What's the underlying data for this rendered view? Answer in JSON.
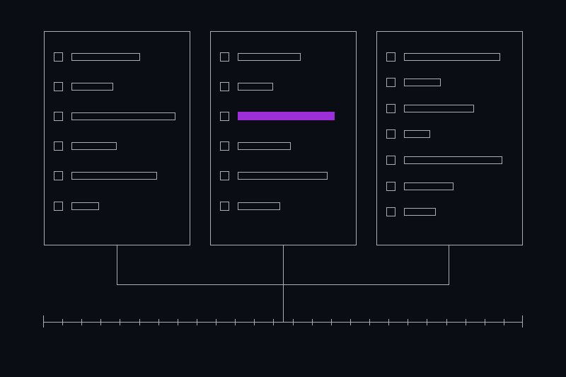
{
  "colors": {
    "background": "#0b0d14",
    "line": "#a9adb6",
    "highlight": "#9b2fd8"
  },
  "lists": [
    {
      "name": "left",
      "rows": [
        {
          "bar_fraction": 0.66,
          "selected": false
        },
        {
          "bar_fraction": 0.4,
          "selected": false
        },
        {
          "bar_fraction": 1.0,
          "selected": false
        },
        {
          "bar_fraction": 0.43,
          "selected": false
        },
        {
          "bar_fraction": 0.82,
          "selected": false
        },
        {
          "bar_fraction": 0.26,
          "selected": false
        }
      ]
    },
    {
      "name": "middle",
      "rows": [
        {
          "bar_fraction": 0.64,
          "selected": false
        },
        {
          "bar_fraction": 0.36,
          "selected": false
        },
        {
          "bar_fraction": 1.0,
          "selected": true
        },
        {
          "bar_fraction": 0.54,
          "selected": false
        },
        {
          "bar_fraction": 0.92,
          "selected": false
        },
        {
          "bar_fraction": 0.43,
          "selected": false
        }
      ]
    },
    {
      "name": "right",
      "rows": [
        {
          "bar_fraction": 0.98,
          "selected": false
        },
        {
          "bar_fraction": 0.37,
          "selected": false
        },
        {
          "bar_fraction": 0.71,
          "selected": false
        },
        {
          "bar_fraction": 0.26,
          "selected": false
        },
        {
          "bar_fraction": 1.0,
          "selected": false
        },
        {
          "bar_fraction": 0.5,
          "selected": false
        },
        {
          "bar_fraction": 0.32,
          "selected": false
        }
      ]
    }
  ],
  "timeline": {
    "tick_count": 26
  }
}
